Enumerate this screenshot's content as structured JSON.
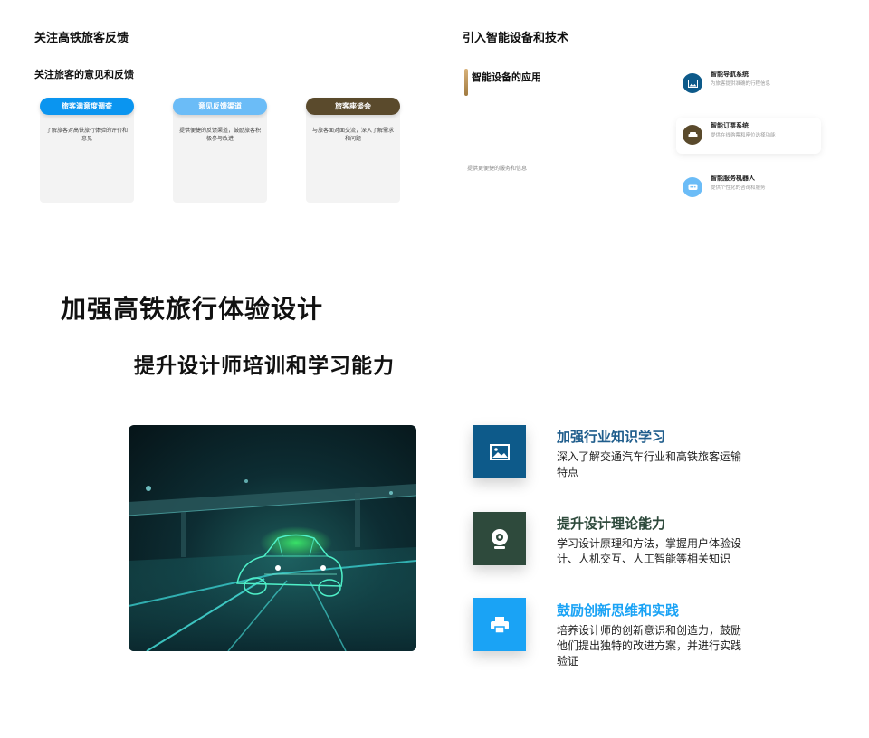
{
  "colors": {
    "blue": "#0a95f0",
    "light_blue": "#6bbcf7",
    "olive": "#5a4a2c",
    "navy": "#0d5a8a",
    "dark_green": "#2e4a3c",
    "bright_blue": "#1aa3f5",
    "accent_title": "#1f5d8c"
  },
  "feedback": {
    "title": "关注高铁旅客反馈",
    "subtitle": "关注旅客的意见和反馈",
    "cards": [
      {
        "label": "旅客满意度调查",
        "text": "了解旅客对高铁旅行体验的评价和意见"
      },
      {
        "label": "意见反馈渠道",
        "text": "提供便捷的反馈渠道，鼓励旅客积极参与改进"
      },
      {
        "label": "旅客座谈会",
        "text": "与旅客面对面交流，深入了解需求和问题"
      }
    ]
  },
  "smart": {
    "title": "引入智能设备和技术",
    "subtitle": "智能设备的应用",
    "note": "提供更便捷的服务和信息",
    "items": [
      {
        "name": "智能导航系统",
        "desc": "为旅客提供准确的行程信息",
        "icon": "image-icon"
      },
      {
        "name": "智能订票系统",
        "desc": "提供在线购票和座位选择功能",
        "icon": "sofa-icon"
      },
      {
        "name": "智能服务机器人",
        "desc": "提供个性化的咨询和服务",
        "icon": "chat-icon"
      }
    ]
  },
  "main": {
    "title": "加强高铁旅行体验设计",
    "subtitle": "提升设计师培训和学习能力",
    "features": [
      {
        "title": "加强行业知识学习",
        "desc": "深入了解交通汽车行业和高铁旅客运输特点",
        "icon": "image-icon"
      },
      {
        "title": "提升设计理论能力",
        "desc": "学习设计原理和方法，掌握用户体验设计、人机交互、人工智能等相关知识",
        "icon": "webcam-icon"
      },
      {
        "title": "鼓励创新思维和实践",
        "desc": "培养设计师的创新意识和创造力，鼓励他们提出独特的改进方案，并进行实践验证",
        "icon": "printer-icon"
      }
    ]
  }
}
